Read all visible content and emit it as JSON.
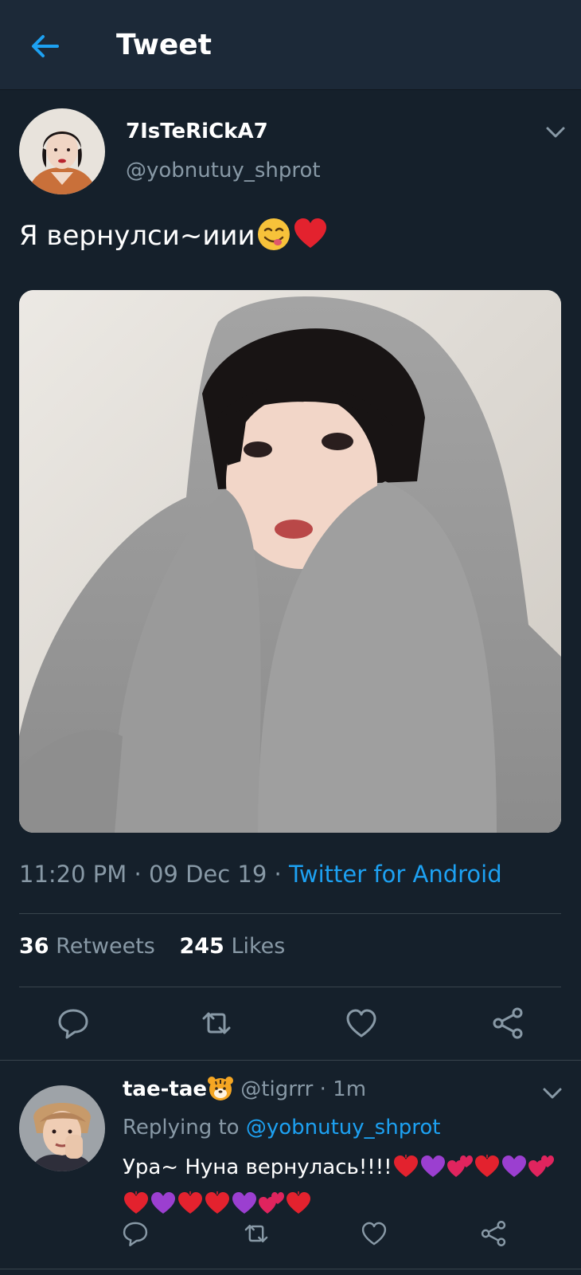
{
  "header": {
    "title": "Tweet"
  },
  "tweet": {
    "display_name": "7IsTeRiCkA7",
    "handle": "@yobnutuy_shprot",
    "text": "Я вернулси~иии",
    "emojis": [
      "yum-face-emoji",
      "red-heart-emoji"
    ],
    "time": "11:20 PM",
    "date": "09 Dec 19",
    "source": "Twitter for Android",
    "retweets_count": "36",
    "retweets_label": "Retweets",
    "likes_count": "245",
    "likes_label": "Likes"
  },
  "reply": {
    "display_name": "tae-tae",
    "name_emoji": "tiger-face-emoji",
    "handle": "@tigrrr",
    "time": "1m",
    "replying_to_label": "Replying to",
    "replying_to_handle": "@yobnutuy_shprot",
    "text": "Ура~ Нуна вернулась!!!!",
    "emojis": [
      "red-heart",
      "purple-heart",
      "two-hearts",
      "red-heart",
      "purple-heart",
      "two-hearts",
      "red-heart",
      "purple-heart",
      "red-heart",
      "red-heart",
      "purple-heart",
      "two-hearts",
      "red-heart"
    ]
  },
  "colors": {
    "background": "#15202b",
    "header": "#1c2938",
    "accent": "#1da1f2",
    "muted": "#8899a6",
    "divider": "#38444d"
  }
}
